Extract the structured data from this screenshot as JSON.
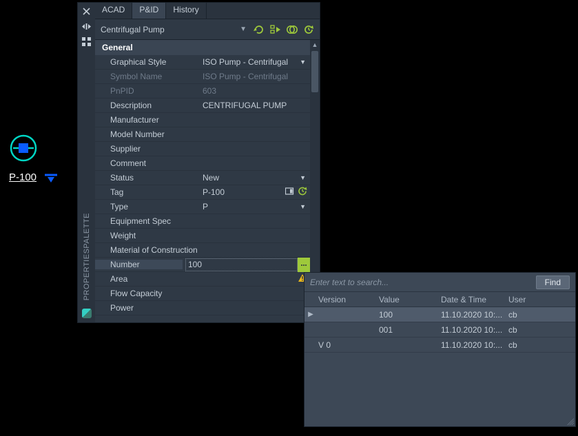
{
  "canvas": {
    "tag_text": "P-100"
  },
  "palette": {
    "title_vertical": "PROPERTIESPALETTE",
    "tabs": [
      {
        "label": "ACAD",
        "active": false
      },
      {
        "label": "P&ID",
        "active": true
      },
      {
        "label": "History",
        "active": false
      }
    ],
    "object_name": "Centrifugal Pump",
    "section": "General",
    "rows": [
      {
        "label": "Graphical Style",
        "value": "ISO Pump - Centrifugal",
        "dropdown": true
      },
      {
        "label": "Symbol Name",
        "value": "ISO Pump - Centrifugal",
        "dim": true
      },
      {
        "label": "PnPID",
        "value": "603",
        "dim": true
      },
      {
        "label": "Description",
        "value": "CENTRIFUGAL PUMP"
      },
      {
        "label": "Manufacturer",
        "value": ""
      },
      {
        "label": "Model Number",
        "value": ""
      },
      {
        "label": "Supplier",
        "value": ""
      },
      {
        "label": "Comment",
        "value": ""
      },
      {
        "label": "Status",
        "value": "New",
        "dropdown": true
      },
      {
        "label": "Tag",
        "value": "P-100",
        "tag_icons": true
      },
      {
        "label": "Type",
        "value": "P",
        "dropdown": true
      },
      {
        "label": "Equipment Spec",
        "value": ""
      },
      {
        "label": "Weight",
        "value": ""
      },
      {
        "label": "Material of Construction",
        "value": ""
      },
      {
        "label": "Number",
        "value": "100",
        "editing": true
      },
      {
        "label": "Area",
        "value": "",
        "area_icon": true
      },
      {
        "label": "Flow Capacity",
        "value": ""
      },
      {
        "label": "Power",
        "value": ""
      }
    ]
  },
  "history": {
    "search_placeholder": "Enter text to search...",
    "find_label": "Find",
    "columns": {
      "version": "Version",
      "value": "Value",
      "date": "Date & Time",
      "user": "User"
    },
    "rows": [
      {
        "version": "",
        "value": "100",
        "date": "11.10.2020 10:...",
        "user": "cb",
        "current": true,
        "selected": true
      },
      {
        "version": "",
        "value": "001",
        "date": "11.10.2020 10:...",
        "user": "cb"
      },
      {
        "version": "V 0",
        "value": "",
        "date": "11.10.2020 10:...",
        "user": "cb"
      }
    ]
  }
}
